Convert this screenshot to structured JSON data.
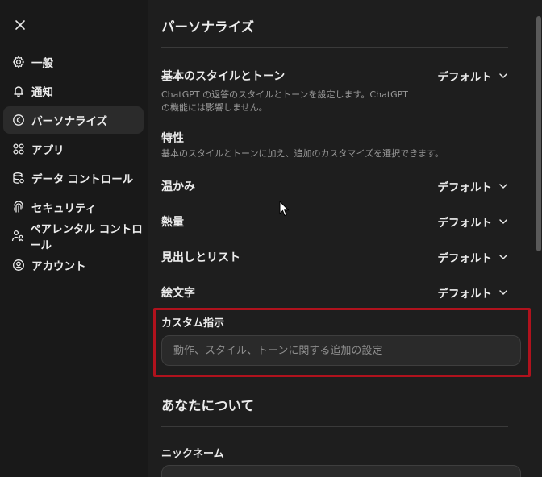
{
  "sidebar": {
    "items": [
      {
        "label": "一般",
        "icon": "gear-icon"
      },
      {
        "label": "通知",
        "icon": "bell-icon"
      },
      {
        "label": "パーソナライズ",
        "icon": "personalize-icon",
        "active": true
      },
      {
        "label": "アプリ",
        "icon": "apps-grid-icon"
      },
      {
        "label": "データ コントロール",
        "icon": "database-icon"
      },
      {
        "label": "セキュリティ",
        "icon": "fingerprint-icon"
      },
      {
        "label": "ペアレンタル コントロール",
        "icon": "parental-icon"
      },
      {
        "label": "アカウント",
        "icon": "account-icon"
      }
    ]
  },
  "main": {
    "title": "パーソナライズ",
    "base_style": {
      "label": "基本のスタイルとトーン",
      "description": "ChatGPT の返答のスタイルとトーンを設定します。ChatGPT の機能には影響しません。",
      "value": "デフォルト"
    },
    "traits": {
      "label": "特性",
      "description": "基本のスタイルとトーンに加え、追加のカスタマイズを選択できます。"
    },
    "warmth": {
      "label": "温かみ",
      "value": "デフォルト"
    },
    "enthusiasm": {
      "label": "熱量",
      "value": "デフォルト"
    },
    "headers_lists": {
      "label": "見出しとリスト",
      "value": "デフォルト"
    },
    "emoji": {
      "label": "絵文字",
      "value": "デフォルト"
    },
    "custom_instructions": {
      "label": "カスタム指示",
      "placeholder": "動作、スタイル、トーンに関する追加の設定"
    },
    "about_you": {
      "title": "あなたについて"
    },
    "nickname": {
      "label": "ニックネーム"
    }
  },
  "colors": {
    "highlight": "#b0121d",
    "sidebar_bg": "#191919",
    "main_bg": "#1e1e1e",
    "active_item_bg": "#2b2b2b"
  }
}
